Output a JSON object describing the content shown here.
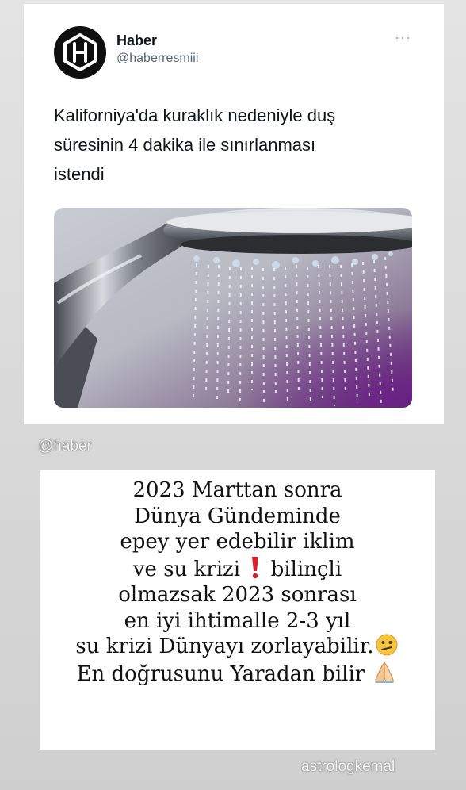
{
  "tweet": {
    "author_name": "Haber",
    "author_handle": "@haberresmiii",
    "more_label": "···",
    "text_lines": [
      "Kaliforniya'da kuraklık nedeniyle duş",
      "süresinin 4 dakika ile sınırlanması",
      "istendi"
    ],
    "media_icon": "shower-head-photo"
  },
  "mention_sticker": "@haber",
  "story_text": {
    "line1": "2023 Marttan sonra",
    "line2": "Dünya Gündeminde",
    "line3": "epey yer edebilir iklim",
    "line4_a": "ve su krizi",
    "line4_b": "bilinçli",
    "line5": "olmazsak 2023 sonrası",
    "line6": "en iyi ihtimalle 2-3 yıl",
    "line7": "su krizi Dünyayı zorlayabilir.",
    "line8": "En doğrusunu Yaradan bilir"
  },
  "emojis": [
    "exclamation-emoji",
    "confused-face-emoji",
    "praying-hands-emoji"
  ],
  "watermark": "astrologkemal",
  "colors": {
    "text_dark": "#0f1419",
    "handle_gray": "#536471",
    "exclamation_red": "#d8202a"
  }
}
